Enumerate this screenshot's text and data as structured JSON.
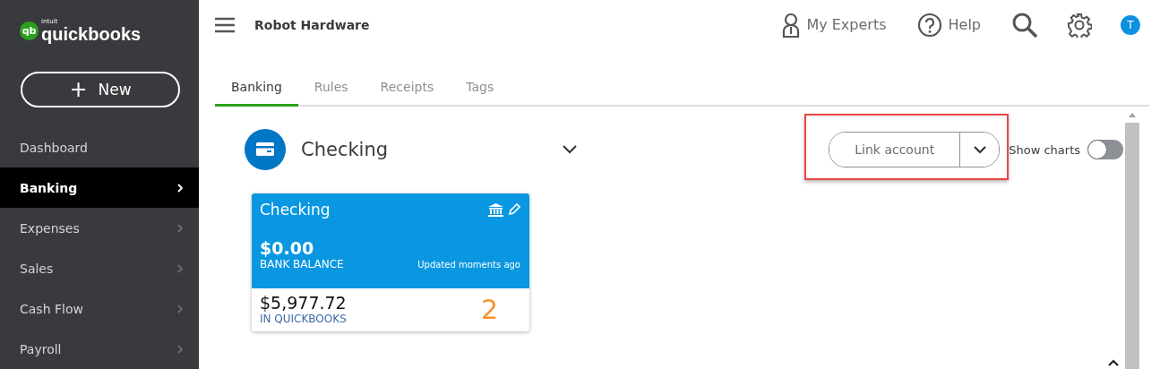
{
  "logo": {
    "mark": "qb",
    "small": "intuit",
    "name": "quickbooks"
  },
  "new_button": {
    "icon": "+",
    "label": "New"
  },
  "sidebar": {
    "items": [
      {
        "label": "Dashboard",
        "selected": false,
        "has_arrow": false
      },
      {
        "label": "Banking",
        "selected": true,
        "has_arrow": true
      },
      {
        "label": "Expenses",
        "selected": false,
        "has_arrow": true
      },
      {
        "label": "Sales",
        "selected": false,
        "has_arrow": true
      },
      {
        "label": "Cash Flow",
        "selected": false,
        "has_arrow": true
      },
      {
        "label": "Payroll",
        "selected": false,
        "has_arrow": true
      }
    ]
  },
  "header": {
    "company": "Robot Hardware",
    "my_experts": "My Experts",
    "help": "Help",
    "avatar": "T"
  },
  "tabs": [
    {
      "label": "Banking",
      "selected": true
    },
    {
      "label": "Rules",
      "selected": false
    },
    {
      "label": "Receipts",
      "selected": false
    },
    {
      "label": "Tags",
      "selected": false
    }
  ],
  "account": {
    "name": "Checking"
  },
  "link_account": {
    "label": "Link account",
    "highlighted": true
  },
  "show_charts": {
    "label": "Show charts",
    "on": false
  },
  "card": {
    "title": "Checking",
    "bank_balance": "$0.00",
    "bank_balance_label": "BANK BALANCE",
    "updated": "Updated moments ago",
    "qb_balance": "$5,977.72",
    "qb_label": "IN QUICKBOOKS",
    "count": "2"
  }
}
